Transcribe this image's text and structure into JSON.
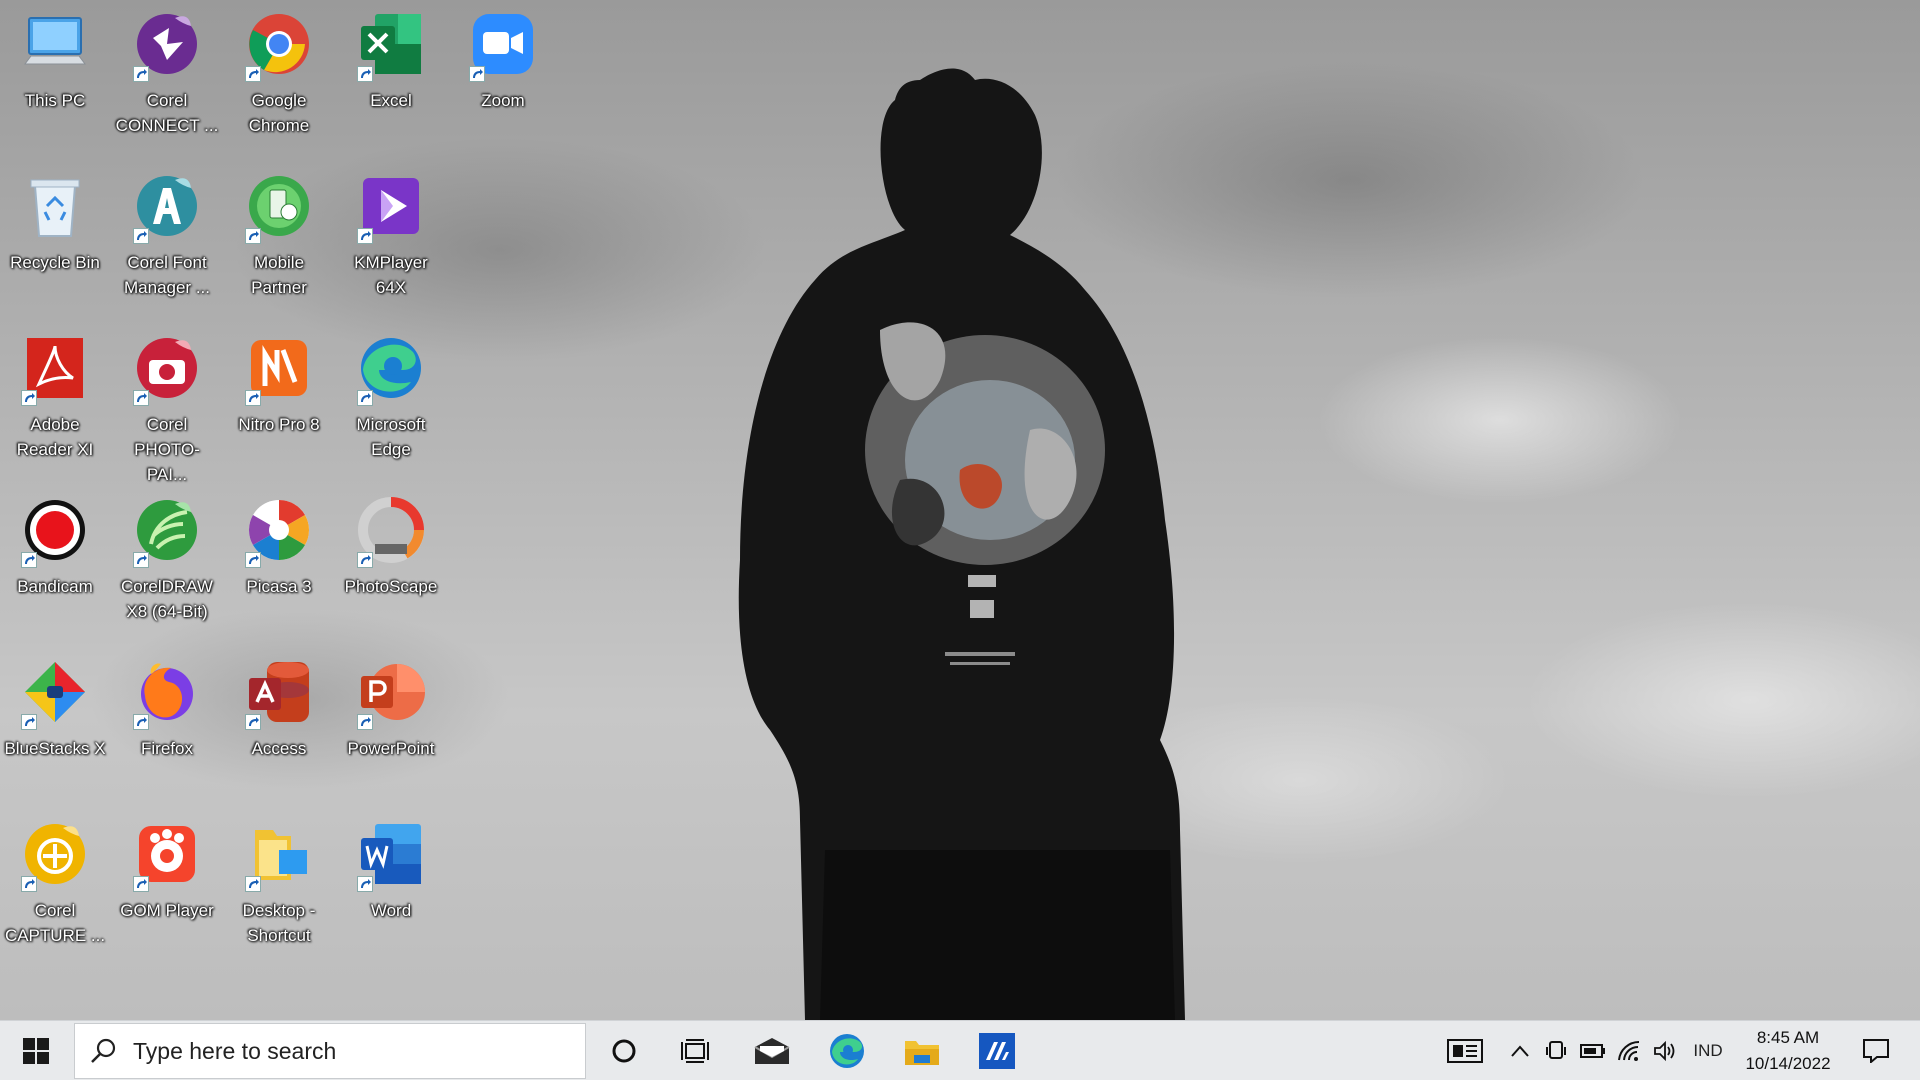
{
  "desktop_icons": [
    {
      "label": "This PC",
      "icon": "this-pc-icon",
      "shortcut": false
    },
    {
      "label": "Corel CONNECT ...",
      "icon": "corel-connect-icon",
      "shortcut": true
    },
    {
      "label": "Google Chrome",
      "icon": "chrome-icon",
      "shortcut": true
    },
    {
      "label": "Excel",
      "icon": "excel-icon",
      "shortcut": true
    },
    {
      "label": "Zoom",
      "icon": "zoom-icon",
      "shortcut": true
    },
    {
      "label": "Recycle Bin",
      "icon": "recycle-bin-icon",
      "shortcut": false
    },
    {
      "label": "Corel Font Manager ...",
      "icon": "corel-font-manager-icon",
      "shortcut": true
    },
    {
      "label": "Mobile Partner",
      "icon": "mobile-partner-icon",
      "shortcut": true
    },
    {
      "label": "KMPlayer 64X",
      "icon": "kmplayer-icon",
      "shortcut": true
    },
    {
      "label": "Adobe Reader XI",
      "icon": "adobe-reader-icon",
      "shortcut": true
    },
    {
      "label": "Corel PHOTO-PAI...",
      "icon": "corel-photo-paint-icon",
      "shortcut": true
    },
    {
      "label": "Nitro Pro 8",
      "icon": "nitro-pro-icon",
      "shortcut": true
    },
    {
      "label": "Microsoft Edge",
      "icon": "edge-icon",
      "shortcut": true
    },
    {
      "label": "Bandicam",
      "icon": "bandicam-icon",
      "shortcut": true
    },
    {
      "label": "CorelDRAW X8 (64-Bit)",
      "icon": "coreldraw-icon",
      "shortcut": true
    },
    {
      "label": "Picasa 3",
      "icon": "picasa-icon",
      "shortcut": true
    },
    {
      "label": "PhotoScape",
      "icon": "photoscape-icon",
      "shortcut": true
    },
    {
      "label": "BlueStacks X",
      "icon": "bluestacks-icon",
      "shortcut": true
    },
    {
      "label": "Firefox",
      "icon": "firefox-icon",
      "shortcut": true
    },
    {
      "label": "Access",
      "icon": "access-icon",
      "shortcut": true
    },
    {
      "label": "PowerPoint",
      "icon": "powerpoint-icon",
      "shortcut": true
    },
    {
      "label": "Corel CAPTURE ...",
      "icon": "corel-capture-icon",
      "shortcut": true
    },
    {
      "label": "GOM Player",
      "icon": "gom-player-icon",
      "shortcut": true
    },
    {
      "label": "Desktop - Shortcut",
      "icon": "folder-icon",
      "shortcut": true
    },
    {
      "label": "Word",
      "icon": "word-icon",
      "shortcut": true
    }
  ],
  "taskbar": {
    "search_placeholder": "Type here to search",
    "pinned": [
      "cortana-icon",
      "task-view-icon",
      "mail-icon",
      "edge-icon",
      "file-explorer-icon",
      "app-icon"
    ],
    "tray": {
      "language": "IND",
      "time": "8:45 AM",
      "date": "10/14/2022"
    }
  }
}
